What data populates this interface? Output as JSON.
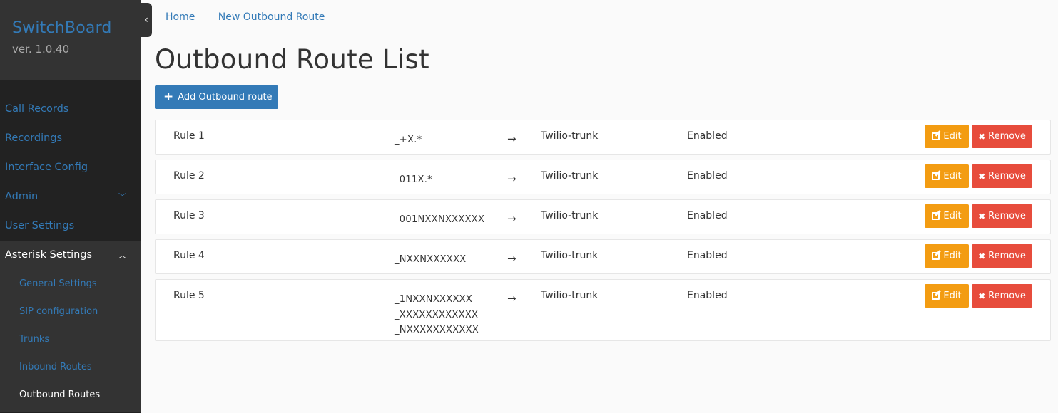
{
  "sidebar": {
    "brand": {
      "title": "SwitchBoard",
      "version": "ver. 1.0.40"
    },
    "items": [
      {
        "label": "Call Records"
      },
      {
        "label": "Recordings"
      },
      {
        "label": "Interface Config"
      },
      {
        "label": "Admin",
        "chevron": "chevron-down"
      },
      {
        "label": "User Settings"
      },
      {
        "label": "Asterisk Settings",
        "chevron": "chevron-up",
        "expanded": true
      }
    ],
    "subitems": [
      {
        "label": "General Settings"
      },
      {
        "label": "SIP configuration"
      },
      {
        "label": "Trunks"
      },
      {
        "label": "Inbound Routes"
      },
      {
        "label": "Outbound Routes",
        "active": true
      }
    ],
    "toggle_icon": "‹"
  },
  "breadcrumb": [
    {
      "label": "Home"
    },
    {
      "label": "New Outbound Route"
    }
  ],
  "page": {
    "title": "Outbound Route List",
    "add_button": {
      "icon": "+",
      "label": "Add Outbound route"
    }
  },
  "routes": [
    {
      "name": "Rule 1",
      "patterns": [
        "_+X.*"
      ],
      "arrow": "→",
      "trunk": "Twilio-trunk",
      "status": "Enabled"
    },
    {
      "name": "Rule 2",
      "patterns": [
        "_011X.*"
      ],
      "arrow": "→",
      "trunk": "Twilio-trunk",
      "status": "Enabled"
    },
    {
      "name": "Rule 3",
      "patterns": [
        "_001NXXNXXXXXX"
      ],
      "arrow": "→",
      "trunk": "Twilio-trunk",
      "status": "Enabled"
    },
    {
      "name": "Rule 4",
      "patterns": [
        "_NXXNXXXXXX"
      ],
      "arrow": "→",
      "trunk": "Twilio-trunk",
      "status": "Enabled"
    },
    {
      "name": "Rule 5",
      "patterns": [
        "_1NXXNXXXXXX",
        "_XXXXXXXXXXXX",
        "_NXXXXXXXXXXX"
      ],
      "arrow": "→",
      "trunk": "Twilio-trunk",
      "status": "Enabled"
    }
  ],
  "actions": {
    "edit_label": "Edit",
    "remove_label": "Remove",
    "remove_icon": "✖"
  },
  "colors": {
    "accent": "#337ab7",
    "edit": "#f39c12",
    "remove": "#e74c3c",
    "sidebar_bg": "#222222",
    "sidebar_header_bg": "#333333"
  }
}
